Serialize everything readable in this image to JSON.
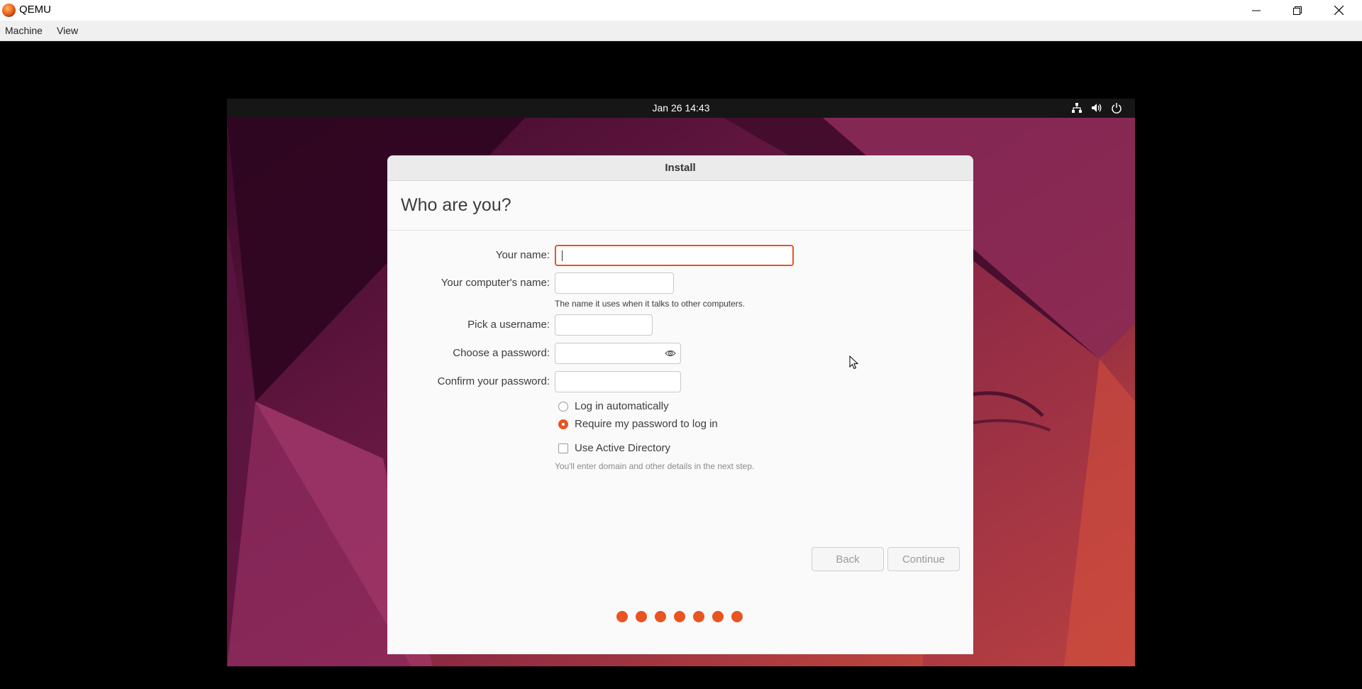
{
  "window": {
    "title": "QEMU"
  },
  "menubar": {
    "items": [
      "Machine",
      "View"
    ]
  },
  "guest_topbar": {
    "clock": "Jan 26  14:43"
  },
  "dialog": {
    "title": "Install",
    "heading": "Who are you?",
    "fields": {
      "name_label": "Your name:",
      "name_value": "",
      "computer_label": "Your computer's name:",
      "computer_value": "",
      "computer_hint": "The name it uses when it talks to other computers.",
      "username_label": "Pick a username:",
      "username_value": "",
      "password_label": "Choose a password:",
      "password_value": "",
      "confirm_label": "Confirm your password:",
      "confirm_value": ""
    },
    "login_options": {
      "auto_label": "Log in automatically",
      "require_label": "Require my password to log in",
      "selected": "Require my password to log in"
    },
    "active_directory": {
      "label": "Use Active Directory",
      "checked": false,
      "hint": "You'll enter domain and other details in the next step."
    },
    "buttons": {
      "back": "Back",
      "continue": "Continue"
    },
    "progress": {
      "steps": 7,
      "completed": 7
    }
  },
  "colors": {
    "accent": "#e95420",
    "topbar": "#161616",
    "dialog_bg": "#fafafa"
  },
  "icons": {
    "app": "qemu-logo-icon",
    "tray": [
      "network-icon",
      "volume-icon",
      "power-icon"
    ],
    "password_toggle": "eye-icon"
  }
}
